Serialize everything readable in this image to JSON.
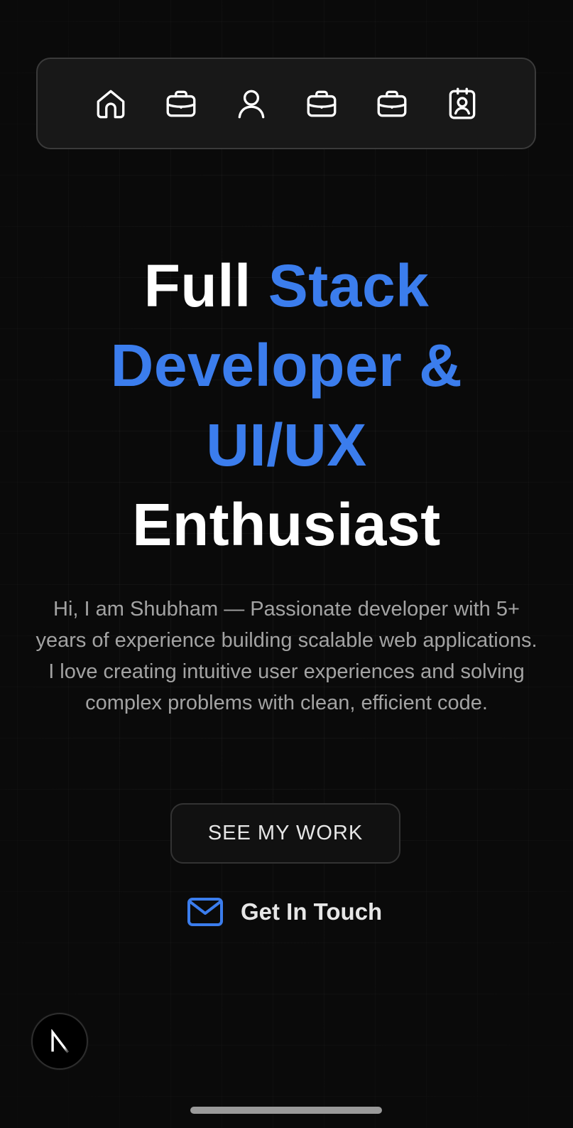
{
  "nav": {
    "items": [
      {
        "icon": "home-icon"
      },
      {
        "icon": "briefcase-icon"
      },
      {
        "icon": "user-icon"
      },
      {
        "icon": "briefcase-icon"
      },
      {
        "icon": "briefcase-icon"
      },
      {
        "icon": "contact-card-icon"
      }
    ]
  },
  "hero": {
    "title_line1_a": "Full ",
    "title_line1_b": "Stack",
    "title_line2": "Developer &",
    "title_line3": "UI/UX",
    "title_line4": "Enthusiast",
    "description": "Hi, I am Shubham — Passionate developer with 5+ years of experience building scalable web applications. I love creating intuitive user experiences and solving complex problems with clean, efficient code."
  },
  "cta": {
    "work_label": "SEE MY WORK",
    "touch_label": "Get In Touch",
    "touch_icon": "mail-icon"
  },
  "badge": {
    "letter": "N",
    "icon": "nextjs-logo-icon"
  },
  "colors": {
    "background": "#0a0a0a",
    "accent": "#3b7ded",
    "text": "#ffffff",
    "muted": "#a3a3a3"
  }
}
